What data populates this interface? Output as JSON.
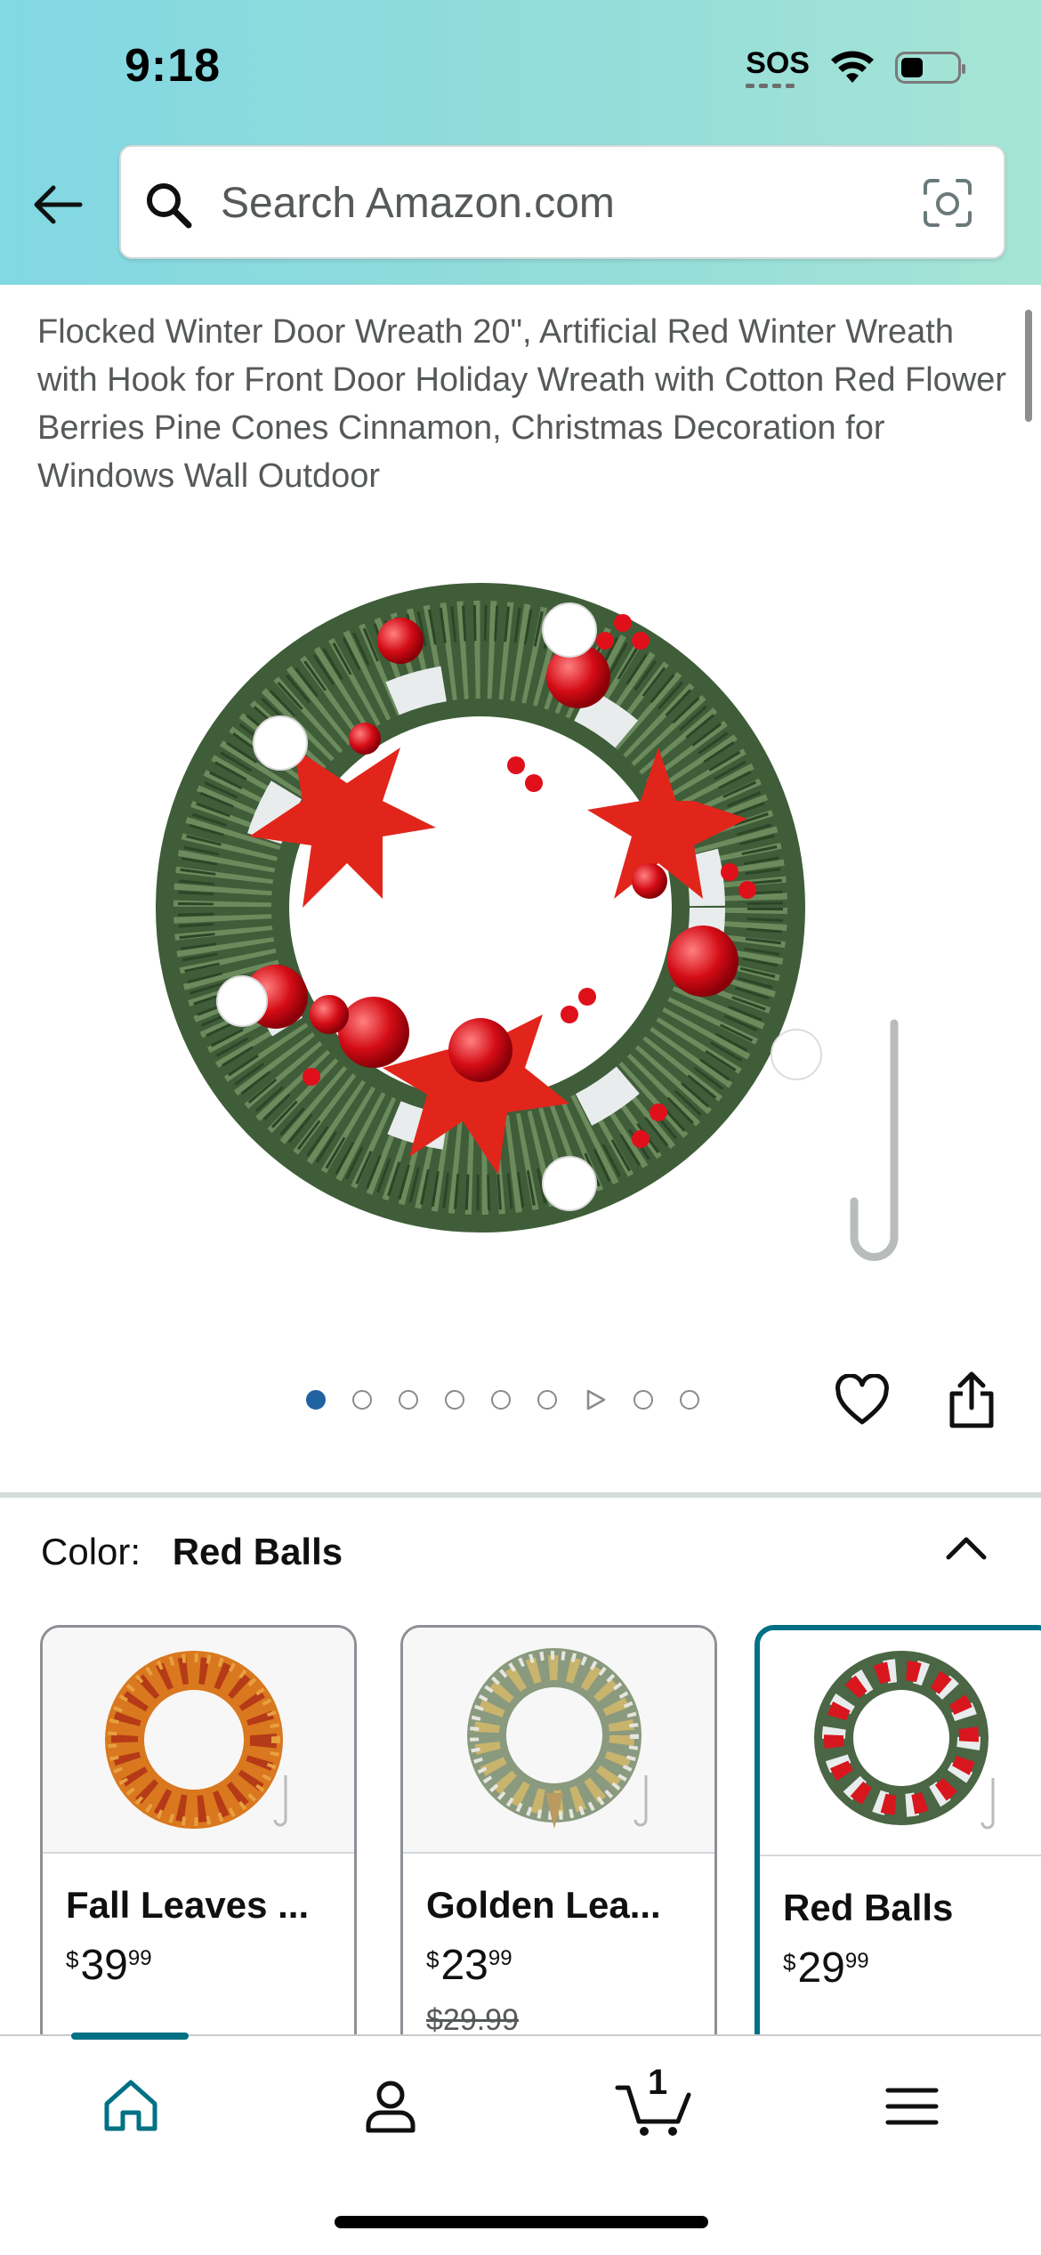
{
  "status_bar": {
    "time": "9:18",
    "sos": "SOS"
  },
  "search": {
    "placeholder": "Search Amazon.com"
  },
  "product": {
    "title": "Flocked Winter Door Wreath 20\", Artificial Red Winter Wreath with Hook for Front Door Holiday Wreath with Cotton Red Flower Berries Pine Cones Cinnamon, Christmas Decoration for Windows Wall Outdoor"
  },
  "carousel": {
    "total_slides": 9,
    "active_index": 0,
    "video_index": 6
  },
  "color": {
    "label": "Color:",
    "selected": "Red Balls",
    "options": [
      {
        "name": "Fall Leaves ...",
        "currency": "$",
        "price_whole": "39",
        "price_fraction": "99",
        "was": ""
      },
      {
        "name": "Golden Lea...",
        "currency": "$",
        "price_whole": "23",
        "price_fraction": "99",
        "was": "$29.99"
      },
      {
        "name": "Red Balls",
        "currency": "$",
        "price_whole": "29",
        "price_fraction": "99",
        "was": ""
      }
    ]
  },
  "bottom_nav": {
    "cart_count": "1",
    "icons": [
      "home-icon",
      "account-icon",
      "cart-icon",
      "menu-icon"
    ]
  },
  "colors": {
    "accent": "#007185",
    "active_dot": "#2162a1",
    "header_start": "#82d8e3",
    "header_end": "#a6e5d6"
  }
}
